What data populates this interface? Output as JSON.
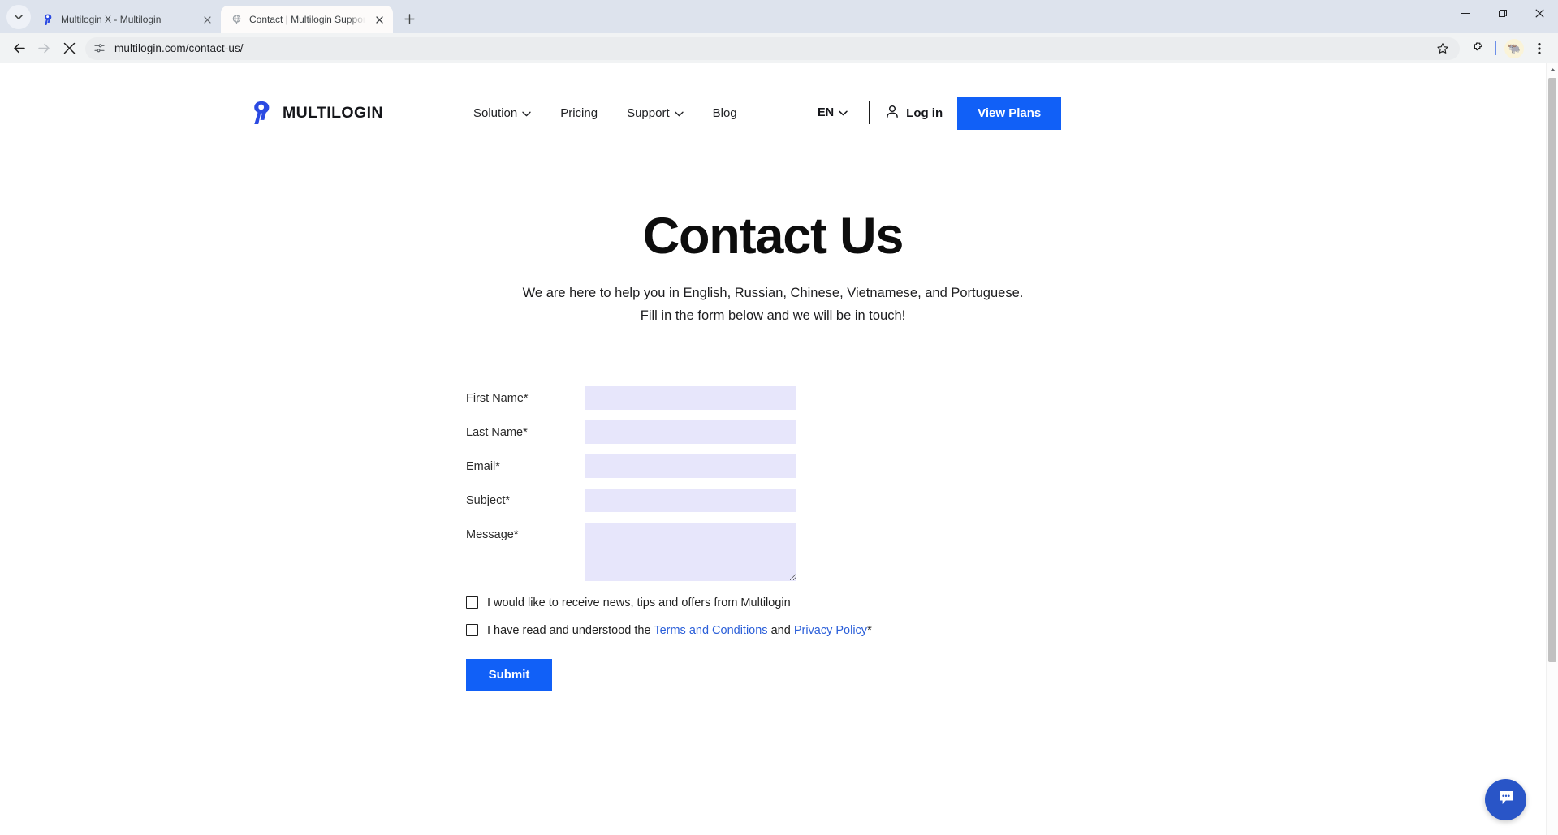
{
  "browser": {
    "tabs": [
      {
        "title": "Multilogin X - Multilogin",
        "favicon": "multilogin-logo-favicon",
        "active": false
      },
      {
        "title": "Contact | Multilogin Support Ce",
        "favicon": "globe-loading-favicon",
        "active": true
      }
    ],
    "new_tab_label": "+",
    "toolbar": {
      "back_icon": "back-arrow-icon",
      "forward_icon": "forward-arrow-icon",
      "stop_icon": "stop-loading-icon",
      "site_settings_icon": "tune-icon",
      "url": "multilogin.com/contact-us/",
      "bookmark_icon": "star-icon",
      "extensions_icon": "puzzle-piece-icon",
      "profile_icon": "profile-avatar-icon",
      "menu_icon": "three-dot-menu-icon"
    },
    "window_controls": {
      "minimize": "minimize-icon",
      "maximize": "maximize-icon",
      "close": "close-icon"
    }
  },
  "site": {
    "logo_text": "MULTILOGIN",
    "nav": [
      {
        "label": "Solution",
        "has_dropdown": true
      },
      {
        "label": "Pricing",
        "has_dropdown": false
      },
      {
        "label": "Support",
        "has_dropdown": true
      },
      {
        "label": "Blog",
        "has_dropdown": false
      }
    ],
    "language": "EN",
    "login_label": "Log in",
    "view_plans_label": "View Plans",
    "accent_color": "#1160f7"
  },
  "hero": {
    "title": "Contact Us",
    "subtitle_line1": "We are here to help you in English, Russian, Chinese, Vietnamese, and Portuguese.",
    "subtitle_line2": "Fill in the form below and we will be in touch!"
  },
  "form": {
    "fields": [
      {
        "label": "First Name*",
        "value": "",
        "type": "text"
      },
      {
        "label": "Last Name*",
        "value": "",
        "type": "text"
      },
      {
        "label": "Email*",
        "value": "",
        "type": "text"
      },
      {
        "label": "Subject*",
        "value": "",
        "type": "text"
      },
      {
        "label": "Message*",
        "value": "",
        "type": "textarea"
      }
    ],
    "field_bg_color": "#e7e6fb",
    "checkboxes": [
      {
        "text": "I would like to receive news, tips and offers from Multilogin",
        "checked": false
      },
      {
        "prefix": "I have read and understood the ",
        "link1": "Terms and Conditions",
        "middle": " and ",
        "link2": "Privacy Policy",
        "suffix": "*",
        "checked": false
      }
    ],
    "submit_label": "Submit"
  },
  "chat": {
    "icon": "chat-bubble-icon",
    "color": "#2955c7"
  }
}
